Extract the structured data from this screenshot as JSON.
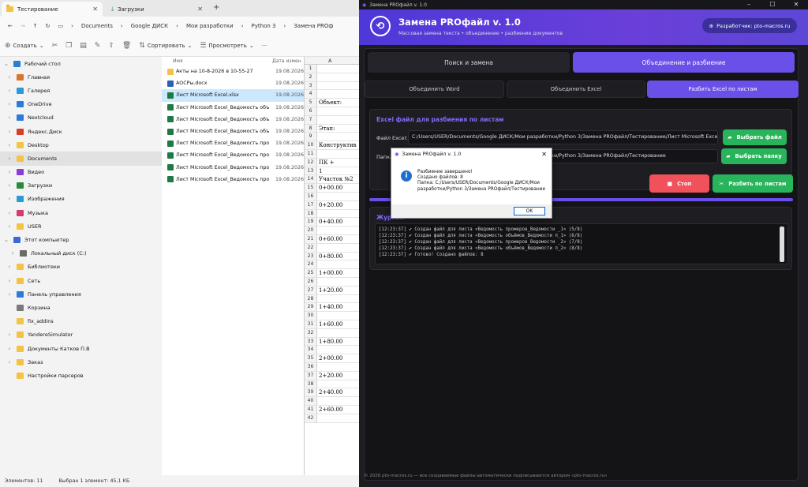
{
  "explorer": {
    "tabs": [
      {
        "label": "Тестирование"
      },
      {
        "label": "Загрузки"
      }
    ],
    "breadcrumbs": [
      "Documents",
      "Google ДИСК",
      "Мои разработки",
      "Python 3",
      "Замена PROф"
    ],
    "toolbar": {
      "create": "Создать",
      "sort": "Сортировать",
      "view": "Просмотреть",
      "more": "···"
    },
    "sidebar": [
      {
        "label": "Рабочий стол",
        "chev": "⌄",
        "icon": "desktop"
      },
      {
        "label": "Главная",
        "chev": "›",
        "icon": "home"
      },
      {
        "label": "Галерея",
        "chev": "›",
        "icon": "gallery"
      },
      {
        "label": "OneDrive",
        "chev": "›",
        "icon": "cloud"
      },
      {
        "label": "Nextcloud",
        "chev": "›",
        "icon": "cloud"
      },
      {
        "label": "Яндекс.Диск",
        "chev": "›",
        "icon": "disk"
      },
      {
        "label": "Desktop",
        "chev": "›",
        "icon": "folder"
      },
      {
        "label": "Documents",
        "chev": "›",
        "icon": "folder"
      },
      {
        "label": "Видео",
        "chev": "›",
        "icon": "video"
      },
      {
        "label": "Загрузки",
        "chev": "›",
        "icon": "download"
      },
      {
        "label": "Изображения",
        "chev": "›",
        "icon": "image"
      },
      {
        "label": "Музыка",
        "chev": "›",
        "icon": "music"
      },
      {
        "label": "USER",
        "chev": "›",
        "icon": "folder"
      },
      {
        "label": "Этот компьютер",
        "chev": "⌄",
        "icon": "pc"
      },
      {
        "label": "Локальный диск (C:)",
        "chev": "›",
        "icon": "drive"
      },
      {
        "label": "Библиотеки",
        "chev": "›",
        "icon": "folder"
      },
      {
        "label": "Сеть",
        "chev": "›",
        "icon": "folder"
      },
      {
        "label": "Панель управления",
        "chev": "›",
        "icon": "control"
      },
      {
        "label": "Корзина",
        "chev": "",
        "icon": "trash"
      },
      {
        "label": "fix_addins",
        "chev": "",
        "icon": "folder"
      },
      {
        "label": "YandereSimulator",
        "chev": "›",
        "icon": "folder"
      },
      {
        "label": "Документы Катков П.В",
        "chev": "›",
        "icon": "folder"
      },
      {
        "label": "Заказ",
        "chev": "›",
        "icon": "folder"
      },
      {
        "label": "Настройки парсеров",
        "chev": "",
        "icon": "folder"
      }
    ],
    "list_header": {
      "name": "Имя",
      "date": "Дата измен"
    },
    "files": [
      {
        "name": "Акты на 10-8-2026 в 10-55-27",
        "date": "19.08.2026",
        "type": "zip"
      },
      {
        "name": "АОСРы.docx",
        "date": "19.08.2026",
        "type": "doc"
      },
      {
        "name": "Лист Microsoft Excel.xlsx",
        "date": "19.08.2026",
        "type": "xls"
      },
      {
        "name": "Лист Microsoft Excel_Ведомость объём...",
        "date": "19.08.2026",
        "type": "xls"
      },
      {
        "name": "Лист Microsoft Excel_Ведомость объём...",
        "date": "19.08.2026",
        "type": "xls"
      },
      {
        "name": "Лист Microsoft Excel_Ведомость объём...",
        "date": "19.08.2026",
        "type": "xls"
      },
      {
        "name": "Лист Microsoft Excel_Ведомость проме...",
        "date": "19.08.2026",
        "type": "xls"
      },
      {
        "name": "Лист Microsoft Excel_Ведомость проме...",
        "date": "19.08.2026",
        "type": "xls"
      },
      {
        "name": "Лист Microsoft Excel_Ведомость проме...",
        "date": "19.08.2026",
        "type": "xls"
      },
      {
        "name": "Лист Microsoft Excel_Ведомость проме...",
        "date": "19.08.2026",
        "type": "xls"
      }
    ],
    "status": {
      "count": "Элементов: 11",
      "selected": "Выбран 1 элемент: 45,1 КБ"
    }
  },
  "excel": {
    "col_a": "A",
    "rows": [
      {
        "n": "1",
        "t": ""
      },
      {
        "n": "2",
        "t": ""
      },
      {
        "n": "3",
        "t": ""
      },
      {
        "n": "4",
        "t": ""
      },
      {
        "n": "5",
        "t": "Объект:"
      },
      {
        "n": "6",
        "t": ""
      },
      {
        "n": "7",
        "t": ""
      },
      {
        "n": "8",
        "t": "Этап:"
      },
      {
        "n": "9",
        "t": ""
      },
      {
        "n": "10",
        "t": "Конструктив"
      },
      {
        "n": "11",
        "t": ""
      },
      {
        "n": "12",
        "t": "ПК +"
      },
      {
        "n": "13",
        "t": "1"
      },
      {
        "n": "14",
        "t": "Участок №2"
      },
      {
        "n": "15",
        "t": "0+00.00"
      },
      {
        "n": "16",
        "t": ""
      },
      {
        "n": "17",
        "t": "0+20.00"
      },
      {
        "n": "18",
        "t": ""
      },
      {
        "n": "19",
        "t": "0+40.00"
      },
      {
        "n": "20",
        "t": ""
      },
      {
        "n": "21",
        "t": "0+60.00"
      },
      {
        "n": "22",
        "t": ""
      },
      {
        "n": "23",
        "t": "0+80.00"
      },
      {
        "n": "24",
        "t": ""
      },
      {
        "n": "25",
        "t": "1+00.00"
      },
      {
        "n": "26",
        "t": ""
      },
      {
        "n": "27",
        "t": "1+20.00"
      },
      {
        "n": "28",
        "t": ""
      },
      {
        "n": "29",
        "t": "1+40.00"
      },
      {
        "n": "30",
        "t": ""
      },
      {
        "n": "31",
        "t": "1+60.00"
      },
      {
        "n": "32",
        "t": ""
      },
      {
        "n": "33",
        "t": "1+80.00"
      },
      {
        "n": "34",
        "t": ""
      },
      {
        "n": "35",
        "t": "2+00.00"
      },
      {
        "n": "36",
        "t": ""
      },
      {
        "n": "37",
        "t": "2+20.00"
      },
      {
        "n": "38",
        "t": ""
      },
      {
        "n": "39",
        "t": "2+40.00"
      },
      {
        "n": "40",
        "t": ""
      },
      {
        "n": "41",
        "t": "2+60.00"
      },
      {
        "n": "42",
        "t": ""
      }
    ]
  },
  "app": {
    "window_title": "Замена PROфайл v. 1.0",
    "title": "Замена PROфайл v. 1.0",
    "subtitle": "Массовая замена текста • объединение • разбиение документов",
    "developer": "Разработчик: pto-macros.ru",
    "main_tabs": [
      "Поиск и замена",
      "Объединение и разбиение"
    ],
    "sub_tabs": [
      "Объединить Word",
      "Объединить Excel",
      "Разбить Excel по листам"
    ],
    "group_title": "Excel файл для разбиения по листам",
    "file_label": "Файл Excel:",
    "file_value": "C:/Users/USER/Documents/Google ДИСК/Мои разработки/Python 3/Замена PROфайл/Тестирование/Лист Microsoft Excel.xlsx",
    "folder_label": "Папка:",
    "folder_value": "C:/Users/USER/Documents/Google ДИСК/Мои разработки/Python 3/Замена PROфайл/Тестирование",
    "choose_file": "Выбрать файл",
    "choose_folder": "Выбрать папку",
    "stop": "Стоп",
    "split": "Разбить по листам",
    "log_title": "Журнал",
    "log_lines": [
      "[12:23:37] ✔ Создан файл для листа «Ведомость промеров_Ведомости _1» (5/8)",
      "[12:23:37] ✔ Создан файл для листа «Ведомость объёмов_Ведомости п_1» (6/8)",
      "[12:23:37] ✔ Создан файл для листа «Ведомость промеров_Ведомости _2» (7/8)",
      "[12:23:37] ✔ Создан файл для листа «Ведомость объёмов_Ведомости п_2» (8/8)",
      "[12:23:37] ✔ Готово! Создано файлов: 8"
    ],
    "footer": "© 2026 pto-macros.ru — все создаваемые файлы автоматически подписываются автором «pto-macros.ru»"
  },
  "dialog": {
    "title": "Замена PROфайл v. 1.0",
    "line1": "Разбиение завершено!",
    "line2": "Создано файлов: 8",
    "line3": "Папка: C:/Users/USER/Documents/Google ДИСК/Мои разработки/Python 3/Замена PROфайл/Тестирование",
    "ok": "OK"
  },
  "colors": {
    "accent": "#6a4fe8",
    "green": "#28b45a",
    "red": "#f0515a"
  }
}
